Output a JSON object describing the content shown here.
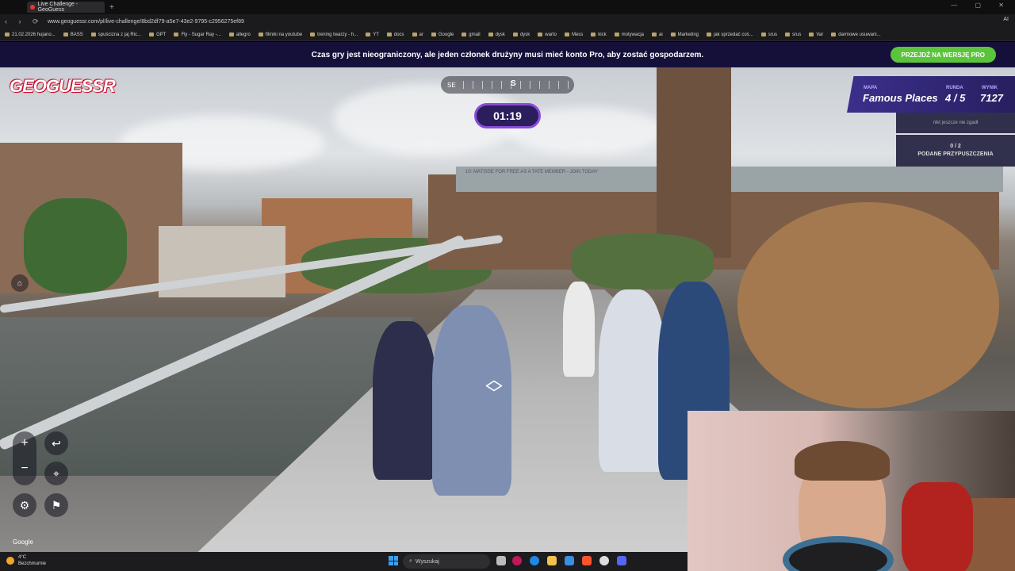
{
  "browser": {
    "tab_title": "Live Challenge - GeoGuess",
    "url": "www.geoguessr.com/pl/live-challenge/8bd2df79-a5e7-43e2-9795-c2956275ef89",
    "profile_label": "AI",
    "bookmarks": [
      "21.02.2026 hujano...",
      "BASS",
      "spuścizna z jaj Ric...",
      "GPT",
      "Fly - Sugar Ray -...",
      "allegro",
      "filmiki na youtube",
      "trening twarzy - h...",
      "YT",
      "docs",
      "ar",
      "Google",
      "gmail",
      "dysk",
      "dysk",
      "warto",
      "Mess",
      "kick",
      "motywacja",
      "ai",
      "Marketing",
      "jak sprzedać coś...",
      "srus",
      "srus",
      "Var",
      "darmowe usuwani..."
    ]
  },
  "promo": {
    "text": "Czas gry jest nieograniczony, ale jeden członek drużyny musi mieć konto Pro, aby zostać gospodarzem.",
    "button": "PRZEJDŹ NA WERSJĘ PRO",
    "button_color": "#5ac43a"
  },
  "game": {
    "logo": "GEOGUESSR",
    "compass_left": "SE",
    "compass_center": "S",
    "timer": "01:19",
    "map_label": "MAPA",
    "map_value": "Famous Places",
    "round_label": "RUNDA",
    "round_value": "4 / 5",
    "score_label": "WYNIK",
    "score_value": "7127",
    "status_text": "nikt jeszcze nie zgadł",
    "guesses_count": "0 / 2",
    "guesses_label": "PODANE PRZYPUSZCZENIA",
    "attribution": "Google",
    "scene_sign": "10: MATISSE FOR FREE AS A TATE MEMBER - JOIN TODAY",
    "icons": [
      "plus-icon",
      "minus-icon",
      "undo-icon",
      "pin-icon",
      "gear-icon",
      "flag-icon",
      "streetview-icon",
      "move-arrows-icon"
    ]
  },
  "taskbar": {
    "temperature": "4°C",
    "weather": "Bezchmurnie",
    "search_placeholder": "Wyszukaj"
  }
}
